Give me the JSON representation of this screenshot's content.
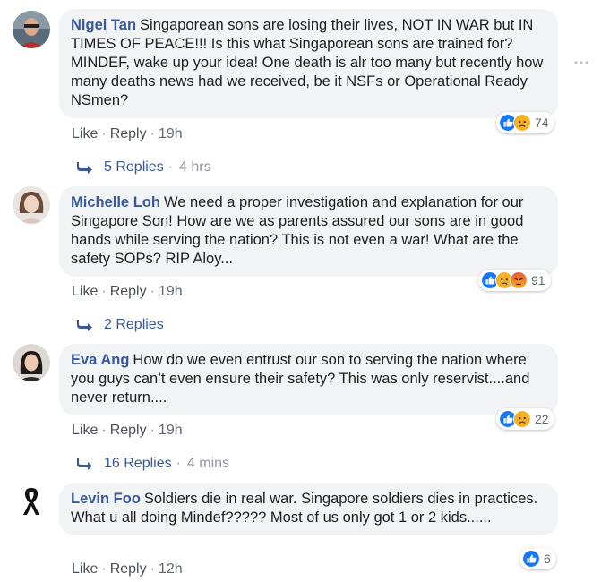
{
  "comments": [
    {
      "author": "Nigel Tan",
      "text": "Singaporean sons are losing their lives, NOT IN WAR but IN TIMES OF PEACE!!! Is this what Singaporean sons are trained for? MINDEF, wake up your idea! One death is alr too many but recently how many deaths news had we received, be it NSFs or Operational Ready NSmen?",
      "like": "Like",
      "reply": "Reply",
      "time": "19h",
      "reaction_icons": [
        "like-icon",
        "sad-icon"
      ],
      "reaction_count": "74",
      "replies": "5 Replies",
      "replies_time": "4 hrs"
    },
    {
      "author": "Michelle Loh",
      "text": "We need a proper investigation and explanation for our Singapore Son! How are we as parents assured our sons are in good hands while serving the nation? This is not even a war! What are the safety SOPs? RIP Aloy...",
      "like": "Like",
      "reply": "Reply",
      "time": "19h",
      "reaction_icons": [
        "like-icon",
        "sad-icon",
        "angry-icon"
      ],
      "reaction_count": "91",
      "replies": "2 Replies",
      "replies_time": ""
    },
    {
      "author": "Eva Ang",
      "text": "How do we even entrust our son to serving the nation where you guys can’t even ensure their safety? This was only reservist....and never return....",
      "like": "Like",
      "reply": "Reply",
      "time": "19h",
      "reaction_icons": [
        "like-icon",
        "sad-icon"
      ],
      "reaction_count": "22",
      "replies": "16 Replies",
      "replies_time": "4 mins"
    },
    {
      "author": "Levin Foo",
      "text": "Soldiers die in real war. Singapore soldiers dies in practices. What u all doing Mindef????? Most of us only got 1 or 2 kids......",
      "like": "Like",
      "reply": "Reply",
      "time": "12h",
      "reaction_icons": [
        "like-icon"
      ],
      "reaction_count": "6"
    }
  ],
  "dot_separator": "·",
  "colors": {
    "author": "#385898",
    "bubble": "#f2f3f5",
    "like": "#1877f2"
  }
}
